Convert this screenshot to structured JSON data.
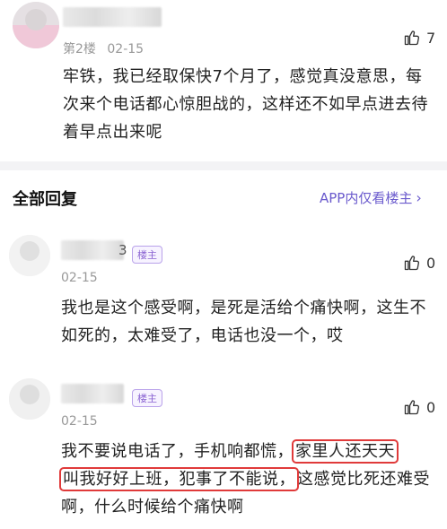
{
  "first_post": {
    "floor": "第2楼",
    "date": "02-15",
    "likes": "7",
    "text": "牢铁，我已经取保快7个月了，感觉真没意思，每次来个电话都心惊胆战的，这样还不如早点进去待着早点出来呢"
  },
  "replies_header": {
    "title": "全部回复",
    "filter_link": "APP内仅看楼主"
  },
  "replies": [
    {
      "name_suffix": "3",
      "badge": "楼主",
      "date": "02-15",
      "likes": "0",
      "text": "我也是这个感受啊，是死是活给个痛快啊，这生不如死的，太难受了，电话也没一个，哎"
    },
    {
      "name_suffix": "",
      "badge": "楼主",
      "date": "02-15",
      "likes": "0",
      "text_parts": [
        "我不要说电话了，手机响都慌，",
        "家里人还天天",
        "叫我好好上班，犯事了不能说，",
        "这感觉比死还难受啊，什么时候给个痛快啊"
      ]
    }
  ]
}
